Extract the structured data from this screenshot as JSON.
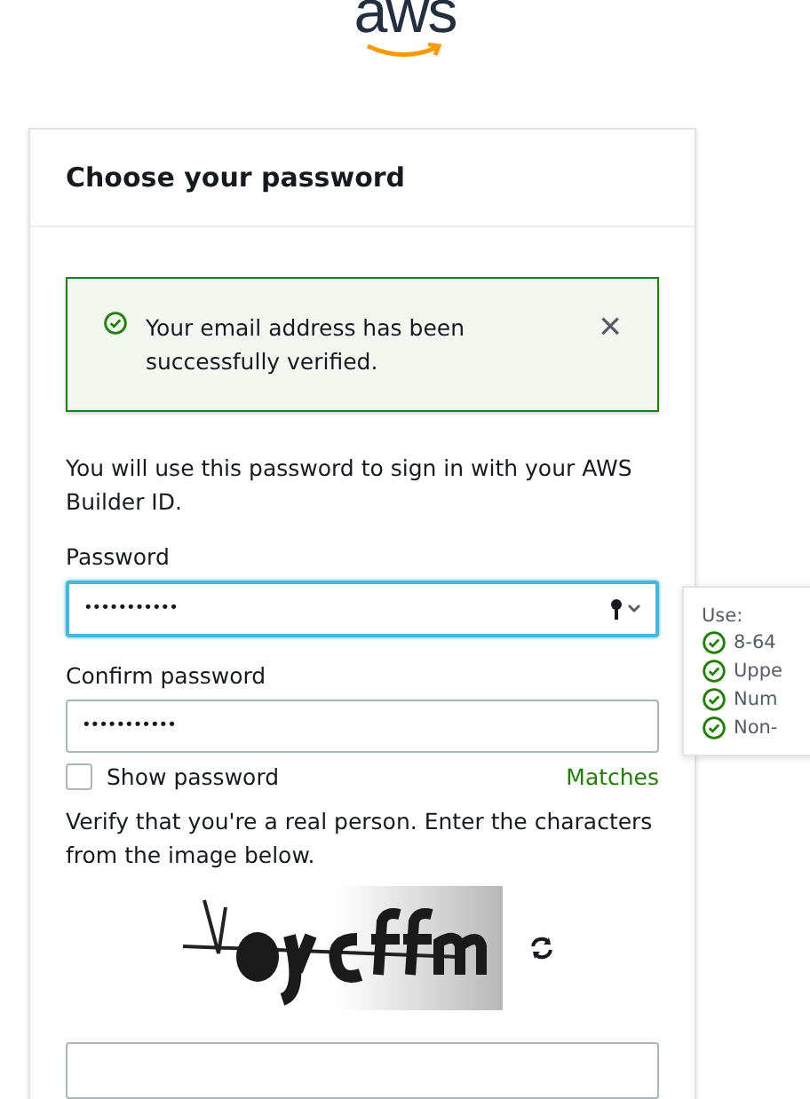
{
  "logo": {
    "text": "aws"
  },
  "card": {
    "title": "Choose your password"
  },
  "alert": {
    "kind": "success",
    "message": "Your email address has been successfully verified.",
    "close": "×"
  },
  "intro": "You will use this password to sign in with your AWS Builder ID.",
  "password": {
    "label": "Password",
    "value": "•••••••••••",
    "focused": true
  },
  "confirm": {
    "label": "Confirm password",
    "value": "•••••••••••",
    "focused": false
  },
  "show_password": {
    "label": "Show password",
    "checked": false
  },
  "match_status": "Matches",
  "captcha": {
    "prompt": "Verify that you're a real person. Enter the characters from the image below."
  },
  "captcha_input": {
    "focused": false
  },
  "requirements": {
    "title": "Use:",
    "items": [
      {
        "text": "8-64",
        "met": true
      },
      {
        "text": "Uppe",
        "met": true
      },
      {
        "text": "Num",
        "met": true
      },
      {
        "text": "Non-",
        "met": true
      }
    ]
  }
}
